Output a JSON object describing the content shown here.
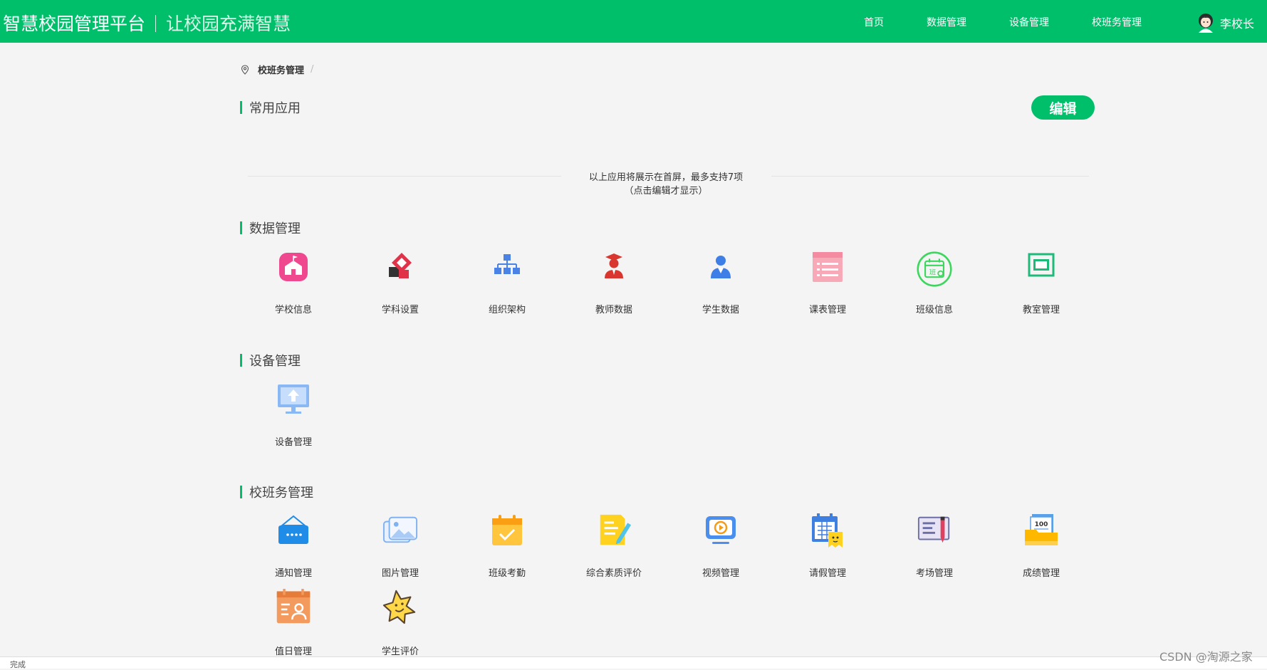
{
  "header": {
    "brand_title": "智慧校园管理平台",
    "brand_slogan": "让校园充满智慧",
    "nav": [
      {
        "label": "首页"
      },
      {
        "label": "数据管理"
      },
      {
        "label": "设备管理"
      },
      {
        "label": "校班务管理"
      }
    ],
    "user_name": "李校长",
    "accent_color": "#00bf6b"
  },
  "breadcrumb": {
    "current": "校班务管理",
    "separator": "/"
  },
  "common_apps": {
    "title": "常用应用",
    "edit_label": "编辑",
    "hint_line1": "以上应用将展示在首屏，最多支持7项",
    "hint_line2": "（点击编辑才显示）"
  },
  "sections": {
    "data": {
      "title": "数据管理",
      "items": [
        {
          "label": "学校信息",
          "icon": "school-info-icon"
        },
        {
          "label": "学科设置",
          "icon": "subject-settings-icon"
        },
        {
          "label": "组织架构",
          "icon": "org-structure-icon"
        },
        {
          "label": "教师数据",
          "icon": "teacher-data-icon"
        },
        {
          "label": "学生数据",
          "icon": "student-data-icon"
        },
        {
          "label": "课表管理",
          "icon": "timetable-icon"
        },
        {
          "label": "班级信息",
          "icon": "class-info-icon",
          "icon_text": "班"
        },
        {
          "label": "教室管理",
          "icon": "classroom-icon"
        }
      ]
    },
    "device": {
      "title": "设备管理",
      "items": [
        {
          "label": "设备管理",
          "icon": "device-monitor-icon"
        }
      ]
    },
    "school": {
      "title": "校班务管理",
      "items": [
        {
          "label": "通知管理",
          "icon": "notice-icon"
        },
        {
          "label": "图片管理",
          "icon": "picture-icon"
        },
        {
          "label": "班级考勤",
          "icon": "attendance-icon"
        },
        {
          "label": "综合素质评价",
          "icon": "quality-eval-icon"
        },
        {
          "label": "视频管理",
          "icon": "video-icon"
        },
        {
          "label": "请假管理",
          "icon": "leave-icon"
        },
        {
          "label": "考场管理",
          "icon": "exam-room-icon"
        },
        {
          "label": "成绩管理",
          "icon": "grades-icon",
          "icon_text": "100"
        },
        {
          "label": "值日管理",
          "icon": "duty-icon"
        },
        {
          "label": "学生评价",
          "icon": "student-eval-icon"
        }
      ]
    }
  },
  "status_bar": {
    "text": "完成"
  },
  "watermark": "CSDN @淘源之家"
}
